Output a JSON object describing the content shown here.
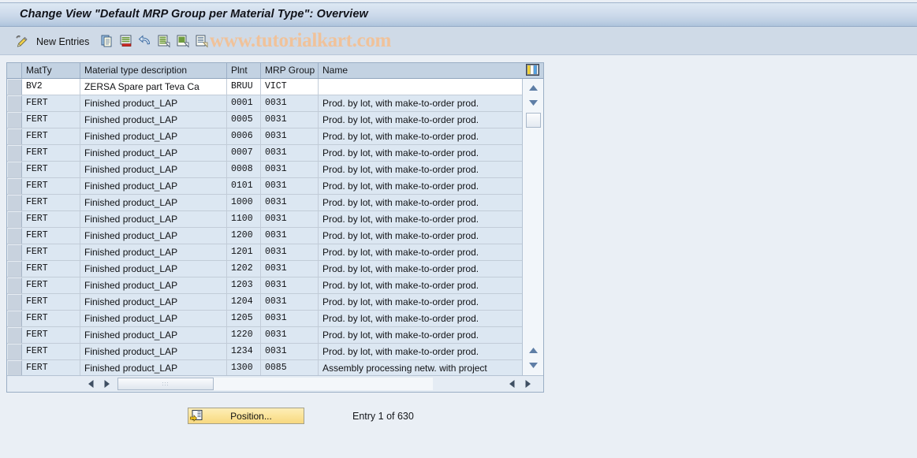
{
  "window": {
    "title": "Change View \"Default MRP Group per Material Type\": Overview"
  },
  "toolbar": {
    "change_display_label": "",
    "new_entries_label": "New Entries",
    "copy_label": "",
    "delete_label": "",
    "undo_label": "",
    "select_all_label": "",
    "select_block_label": "",
    "deselect_all_label": "",
    "watermark": "www.tutorialkart.com"
  },
  "table": {
    "columns": [
      {
        "key": "matty",
        "label": "MatTy"
      },
      {
        "key": "matdesc",
        "label": "Material type description"
      },
      {
        "key": "plnt",
        "label": "Plnt"
      },
      {
        "key": "mrp",
        "label": "MRP Group"
      },
      {
        "key": "name",
        "label": "Name"
      }
    ],
    "rows": [
      {
        "matty": "BV2",
        "matdesc": "ZERSA Spare part Teva Ca",
        "plnt": "BRUU",
        "mrp": "VICT",
        "name": "",
        "current": true
      },
      {
        "matty": "FERT",
        "matdesc": "Finished product_LAP",
        "plnt": "0001",
        "mrp": "0031",
        "name": "Prod. by lot, with make-to-order prod."
      },
      {
        "matty": "FERT",
        "matdesc": "Finished product_LAP",
        "plnt": "0005",
        "mrp": "0031",
        "name": "Prod. by lot, with make-to-order prod."
      },
      {
        "matty": "FERT",
        "matdesc": "Finished product_LAP",
        "plnt": "0006",
        "mrp": "0031",
        "name": "Prod. by lot, with make-to-order prod."
      },
      {
        "matty": "FERT",
        "matdesc": "Finished product_LAP",
        "plnt": "0007",
        "mrp": "0031",
        "name": "Prod. by lot, with make-to-order prod."
      },
      {
        "matty": "FERT",
        "matdesc": "Finished product_LAP",
        "plnt": "0008",
        "mrp": "0031",
        "name": "Prod. by lot, with make-to-order prod."
      },
      {
        "matty": "FERT",
        "matdesc": "Finished product_LAP",
        "plnt": "0101",
        "mrp": "0031",
        "name": "Prod. by lot, with make-to-order prod."
      },
      {
        "matty": "FERT",
        "matdesc": "Finished product_LAP",
        "plnt": "1000",
        "mrp": "0031",
        "name": "Prod. by lot, with make-to-order prod."
      },
      {
        "matty": "FERT",
        "matdesc": "Finished product_LAP",
        "plnt": "1100",
        "mrp": "0031",
        "name": "Prod. by lot, with make-to-order prod."
      },
      {
        "matty": "FERT",
        "matdesc": "Finished product_LAP",
        "plnt": "1200",
        "mrp": "0031",
        "name": "Prod. by lot, with make-to-order prod."
      },
      {
        "matty": "FERT",
        "matdesc": "Finished product_LAP",
        "plnt": "1201",
        "mrp": "0031",
        "name": "Prod. by lot, with make-to-order prod."
      },
      {
        "matty": "FERT",
        "matdesc": "Finished product_LAP",
        "plnt": "1202",
        "mrp": "0031",
        "name": "Prod. by lot, with make-to-order prod."
      },
      {
        "matty": "FERT",
        "matdesc": "Finished product_LAP",
        "plnt": "1203",
        "mrp": "0031",
        "name": "Prod. by lot, with make-to-order prod."
      },
      {
        "matty": "FERT",
        "matdesc": "Finished product_LAP",
        "plnt": "1204",
        "mrp": "0031",
        "name": "Prod. by lot, with make-to-order prod."
      },
      {
        "matty": "FERT",
        "matdesc": "Finished product_LAP",
        "plnt": "1205",
        "mrp": "0031",
        "name": "Prod. by lot, with make-to-order prod."
      },
      {
        "matty": "FERT",
        "matdesc": "Finished product_LAP",
        "plnt": "1220",
        "mrp": "0031",
        "name": "Prod. by lot, with make-to-order prod."
      },
      {
        "matty": "FERT",
        "matdesc": "Finished product_LAP",
        "plnt": "1234",
        "mrp": "0031",
        "name": "Prod. by lot, with make-to-order prod."
      },
      {
        "matty": "FERT",
        "matdesc": "Finished product_LAP",
        "plnt": "1300",
        "mrp": "0085",
        "name": "Assembly processing netw. with project"
      }
    ]
  },
  "footer": {
    "position_label": "Position...",
    "entry_counter": "Entry 1 of 630"
  },
  "colors": {
    "title_bar": "#bfd0e4",
    "toolbar": "#cfdae7",
    "header_row": "#c3d2e2",
    "row_alt": "#dce7f2",
    "row_current": "#ffffff",
    "watermark": "#f0c29a",
    "button_yellow": "#fbe49a",
    "page_bg": "#eaeff5"
  }
}
